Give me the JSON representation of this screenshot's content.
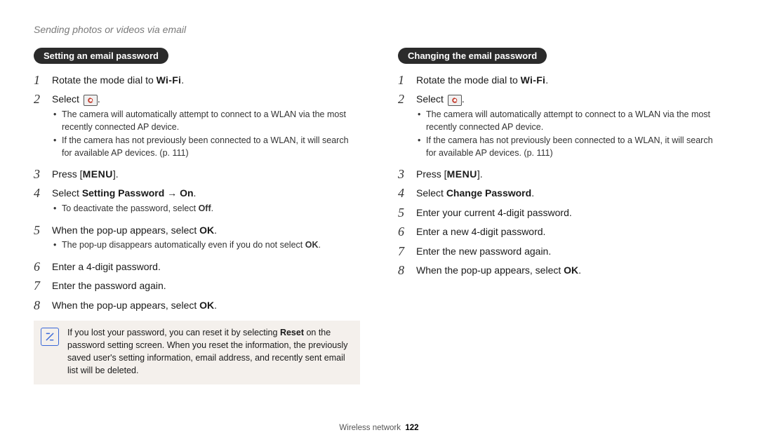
{
  "section_title": "Sending photos or videos via email",
  "left": {
    "heading": "Setting an email password",
    "steps": [
      {
        "n": "1",
        "text_pre": "Rotate the mode dial to ",
        "wifi": "Wi-Fi",
        "text_post": "."
      },
      {
        "n": "2",
        "text_pre": "Select ",
        "icon": "email",
        "text_post": ".",
        "sub": [
          "The camera will automatically attempt to connect to a WLAN via the most recently connected AP device.",
          "If the camera has not previously been connected to a WLAN, it will search for available AP devices. (p. 111)"
        ]
      },
      {
        "n": "3",
        "text_pre": "Press [",
        "menu": "MENU",
        "text_post": "]."
      },
      {
        "n": "4",
        "text_pre": "Select ",
        "bold1": "Setting Password",
        "arrow": " → ",
        "bold2": "On",
        "text_post": ".",
        "sub": [
          "To deactivate the password, select "
        ],
        "sub_bold": "Off",
        "sub_tail": "."
      },
      {
        "n": "5",
        "text_pre": "When the pop-up appears, select ",
        "bold1": "OK",
        "text_post": ".",
        "sub": [
          "The pop-up disappears automatically even if you do not select "
        ],
        "sub_bold": "OK",
        "sub_tail": "."
      },
      {
        "n": "6",
        "plain": "Enter a 4-digit password."
      },
      {
        "n": "7",
        "plain": "Enter the password again."
      },
      {
        "n": "8",
        "text_pre": "When the pop-up appears, select ",
        "bold1": "OK",
        "text_post": "."
      }
    ],
    "note": {
      "pre": "If you lost your password, you can reset it by selecting ",
      "bold": "Reset",
      "post": " on the password setting screen. When you reset the information, the previously saved user's setting information, email address, and recently sent email list will be deleted."
    }
  },
  "right": {
    "heading": "Changing the email password",
    "steps": [
      {
        "n": "1",
        "text_pre": "Rotate the mode dial to ",
        "wifi": "Wi-Fi",
        "text_post": "."
      },
      {
        "n": "2",
        "text_pre": "Select ",
        "icon": "email",
        "text_post": ".",
        "sub": [
          "The camera will automatically attempt to connect to a WLAN via the most recently connected AP device.",
          "If the camera has not previously been connected to a WLAN, it will search for available AP devices. (p. 111)"
        ]
      },
      {
        "n": "3",
        "text_pre": "Press [",
        "menu": "MENU",
        "text_post": "]."
      },
      {
        "n": "4",
        "text_pre": "Select ",
        "bold1": "Change Password",
        "text_post": "."
      },
      {
        "n": "5",
        "plain": "Enter your current 4-digit password."
      },
      {
        "n": "6",
        "plain": "Enter a new 4-digit password."
      },
      {
        "n": "7",
        "plain": "Enter the new password again."
      },
      {
        "n": "8",
        "text_pre": "When the pop-up appears, select ",
        "bold1": "OK",
        "text_post": "."
      }
    ]
  },
  "footer": {
    "label": "Wireless network",
    "page": "122"
  }
}
